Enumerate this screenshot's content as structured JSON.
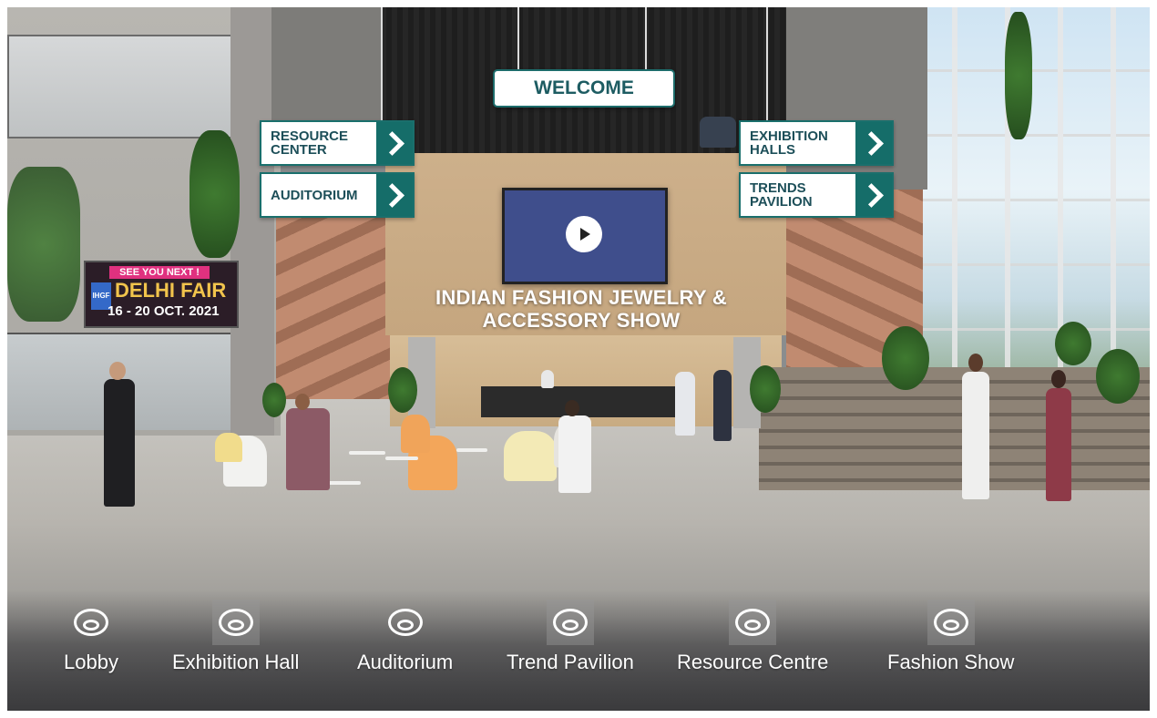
{
  "signs": {
    "welcome": "WELCOME",
    "resource_center": "RESOURCE\nCENTER",
    "auditorium": "AUDITORIUM",
    "exhibition_halls": "EXHIBITION\nHALLS",
    "trends_pavilion": "TRENDS\nPAVILION"
  },
  "show_title": "INDIAN FASHION JEWELRY &\nACCESSORY SHOW",
  "billboard": {
    "see_you": "SEE YOU NEXT !",
    "logo": "IHGF",
    "fair_name": "DELHI FAIR",
    "dates": "16 - 20 OCT. 2021"
  },
  "bottom_nav": [
    {
      "label": "Lobby"
    },
    {
      "label": "Exhibition Hall"
    },
    {
      "label": "Auditorium"
    },
    {
      "label": "Trend Pavilion"
    },
    {
      "label": "Resource Centre"
    },
    {
      "label": "Fashion Show"
    }
  ],
  "colors": {
    "sign_teal": "#156d69",
    "sign_text": "#1d4f59",
    "billboard_pink": "#e0317f",
    "billboard_gold": "#f1c44c"
  }
}
